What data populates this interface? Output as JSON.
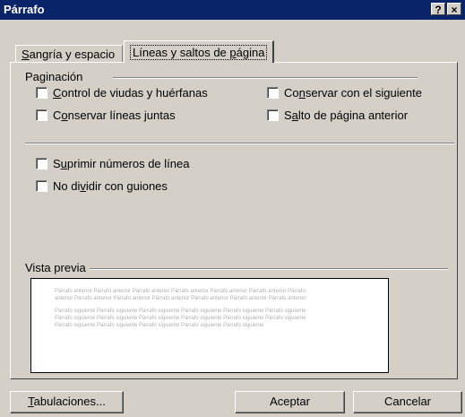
{
  "window": {
    "title": "Párrafo",
    "help_button": "?",
    "close_button": "×"
  },
  "tabs": [
    {
      "prefix": "",
      "accel": "S",
      "rest": "angría y espacio",
      "active": false
    },
    {
      "prefix": "Líneas y saltos de ",
      "accel": "p",
      "rest": "ágina",
      "active": true
    }
  ],
  "pagination": {
    "label": "Paginación",
    "options": [
      {
        "prefix": "",
        "accel": "C",
        "rest": "ontrol de viudas y huérfanas",
        "checked": false
      },
      {
        "prefix": "Co",
        "accel": "n",
        "rest": "servar con el siguiente",
        "checked": false
      },
      {
        "prefix": "C",
        "accel": "o",
        "rest": "nservar líneas juntas",
        "checked": false
      },
      {
        "prefix": "S",
        "accel": "a",
        "rest": "lto de página anterior",
        "checked": false
      }
    ]
  },
  "other_options": [
    {
      "prefix": "S",
      "accel": "u",
      "rest": "primir números de línea",
      "checked": false
    },
    {
      "prefix": "No di",
      "accel": "v",
      "rest": "idir con guiones",
      "checked": false
    }
  ],
  "preview": {
    "label": "Vista previa",
    "lines_before": [
      "Párrafo anterior Párrafo anterior Párrafo anterior Párrafo anterior Párrafo anterior Párrafo anterior Párrafo",
      "anterior Párrafo anterior Párrafo anterior Párrafo anterior Párrafo anterior Párrafo anterior Párrafo anterior"
    ],
    "lines_after": [
      "Párrafo siguiente Párrafo siguiente Párrafo siguiente Párrafo siguiente Párrafo siguiente Párrafo siguiente",
      "Párrafo siguiente Párrafo siguiente Párrafo siguiente Párrafo siguiente Párrafo siguiente Párrafo siguiente",
      "Párrafo siguiente Párrafo siguiente Párrafo siguiente Párrafo siguiente Párrafo siguiente"
    ]
  },
  "buttons": {
    "tabs": {
      "prefix": "",
      "accel": "T",
      "rest": "abulaciones..."
    },
    "ok": "Aceptar",
    "cancel": "Cancelar"
  }
}
